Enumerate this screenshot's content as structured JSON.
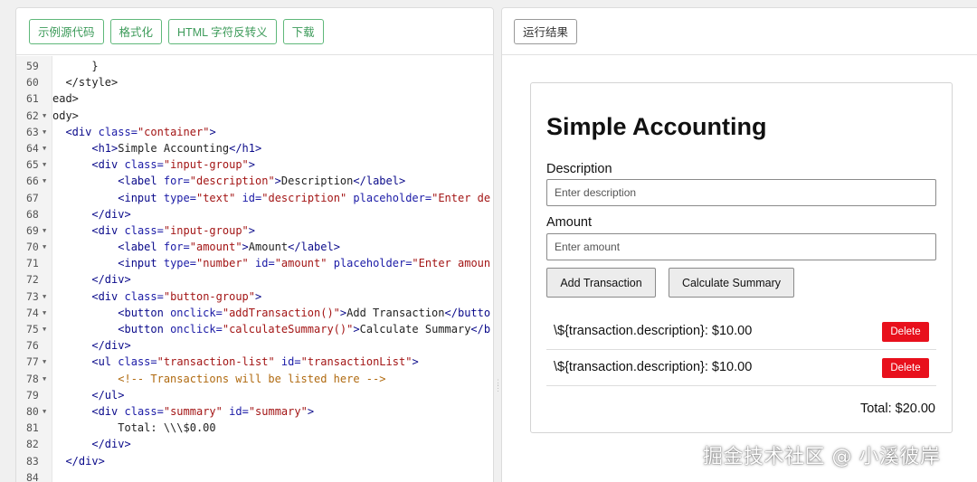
{
  "left_toolbar": {
    "buttons": [
      "示例源代码",
      "格式化",
      "HTML 字符反转义",
      "下载"
    ]
  },
  "right_toolbar": {
    "run_result_label": "运行结果"
  },
  "editor": {
    "lines": [
      {
        "n": "59",
        "fold": false,
        "html": "      }"
      },
      {
        "n": "60",
        "fold": false,
        "html": "  &lt;/style&gt;"
      },
      {
        "n": "61",
        "fold": false,
        "html": "ead&gt;"
      },
      {
        "n": "62",
        "fold": true,
        "html": "ody&gt;"
      },
      {
        "n": "63",
        "fold": true,
        "html": "  <span class=\"tag\">&lt;div</span> <span class=\"attr\">class=</span><span class=\"str\">\"container\"</span><span class=\"tag\">&gt;</span>"
      },
      {
        "n": "64",
        "fold": true,
        "html": "      <span class=\"tag\">&lt;h1&gt;</span>Simple Accounting<span class=\"tag\">&lt;/h1&gt;</span>"
      },
      {
        "n": "65",
        "fold": true,
        "html": "      <span class=\"tag\">&lt;div</span> <span class=\"attr\">class=</span><span class=\"str\">\"input-group\"</span><span class=\"tag\">&gt;</span>"
      },
      {
        "n": "66",
        "fold": true,
        "html": "          <span class=\"tag\">&lt;label</span> <span class=\"attr\">for=</span><span class=\"str\">\"description\"</span><span class=\"tag\">&gt;</span>Description<span class=\"tag\">&lt;/label&gt;</span>"
      },
      {
        "n": "67",
        "fold": false,
        "html": "          <span class=\"tag\">&lt;input</span> <span class=\"attr\">type=</span><span class=\"str\">\"text\"</span> <span class=\"attr\">id=</span><span class=\"str\">\"description\"</span> <span class=\"attr\">placeholder=</span><span class=\"str\">\"Enter de</span>"
      },
      {
        "n": "68",
        "fold": false,
        "html": "      <span class=\"tag\">&lt;/div&gt;</span>"
      },
      {
        "n": "69",
        "fold": true,
        "html": "      <span class=\"tag\">&lt;div</span> <span class=\"attr\">class=</span><span class=\"str\">\"input-group\"</span><span class=\"tag\">&gt;</span>"
      },
      {
        "n": "70",
        "fold": true,
        "html": "          <span class=\"tag\">&lt;label</span> <span class=\"attr\">for=</span><span class=\"str\">\"amount\"</span><span class=\"tag\">&gt;</span>Amount<span class=\"tag\">&lt;/label&gt;</span>"
      },
      {
        "n": "71",
        "fold": false,
        "html": "          <span class=\"tag\">&lt;input</span> <span class=\"attr\">type=</span><span class=\"str\">\"number\"</span> <span class=\"attr\">id=</span><span class=\"str\">\"amount\"</span> <span class=\"attr\">placeholder=</span><span class=\"str\">\"Enter amoun</span>"
      },
      {
        "n": "72",
        "fold": false,
        "html": "      <span class=\"tag\">&lt;/div&gt;</span>"
      },
      {
        "n": "73",
        "fold": true,
        "html": "      <span class=\"tag\">&lt;div</span> <span class=\"attr\">class=</span><span class=\"str\">\"button-group\"</span><span class=\"tag\">&gt;</span>"
      },
      {
        "n": "74",
        "fold": true,
        "html": "          <span class=\"tag\">&lt;button</span> <span class=\"attr\">onclick=</span><span class=\"str\">\"addTransaction()\"</span><span class=\"tag\">&gt;</span>Add Transaction<span class=\"tag\">&lt;/butto</span>"
      },
      {
        "n": "75",
        "fold": true,
        "html": "          <span class=\"tag\">&lt;button</span> <span class=\"attr\">onclick=</span><span class=\"str\">\"calculateSummary()\"</span><span class=\"tag\">&gt;</span>Calculate Summary<span class=\"tag\">&lt;/b</span>"
      },
      {
        "n": "76",
        "fold": false,
        "html": "      <span class=\"tag\">&lt;/div&gt;</span>"
      },
      {
        "n": "77",
        "fold": true,
        "html": "      <span class=\"tag\">&lt;ul</span> <span class=\"attr\">class=</span><span class=\"str\">\"transaction-list\"</span> <span class=\"attr\">id=</span><span class=\"str\">\"transactionList\"</span><span class=\"tag\">&gt;</span>"
      },
      {
        "n": "78",
        "fold": true,
        "html": "          <span class=\"cmt\">&lt;!-- Transactions will be listed here --&gt;</span>"
      },
      {
        "n": "79",
        "fold": false,
        "html": "      <span class=\"tag\">&lt;/ul&gt;</span>"
      },
      {
        "n": "80",
        "fold": true,
        "html": "      <span class=\"tag\">&lt;div</span> <span class=\"attr\">class=</span><span class=\"str\">\"summary\"</span> <span class=\"attr\">id=</span><span class=\"str\">\"summary\"</span><span class=\"tag\">&gt;</span>"
      },
      {
        "n": "81",
        "fold": false,
        "html": "          Total: \\\\\\$0.00"
      },
      {
        "n": "82",
        "fold": false,
        "html": "      <span class=\"tag\">&lt;/div&gt;</span>"
      },
      {
        "n": "83",
        "fold": false,
        "html": "  <span class=\"tag\">&lt;/div&gt;</span>"
      },
      {
        "n": "84",
        "fold": false,
        "html": ""
      }
    ]
  },
  "preview": {
    "title": "Simple Accounting",
    "description_label": "Description",
    "description_placeholder": "Enter description",
    "amount_label": "Amount",
    "amount_placeholder": "Enter amount",
    "add_button": "Add Transaction",
    "calc_button": "Calculate Summary",
    "transactions": [
      {
        "text": "\\${transaction.description}: $10.00",
        "delete_label": "Delete"
      },
      {
        "text": "\\${transaction.description}: $10.00",
        "delete_label": "Delete"
      }
    ],
    "total": "Total: $20.00"
  },
  "watermark": "掘金技术社区 @ 小溪彼岸",
  "colors": {
    "toolbar_button_green": "#3d9b5a",
    "delete_button": "#e8101c"
  }
}
